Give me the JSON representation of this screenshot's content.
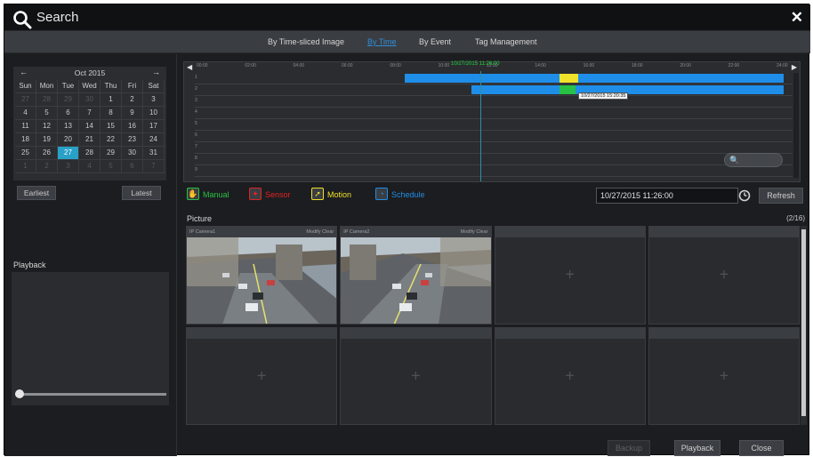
{
  "window": {
    "title": "Search",
    "close_symbol": "✕"
  },
  "tabs": [
    {
      "label": "By Time-sliced Image",
      "active": false
    },
    {
      "label": "By Time",
      "active": true
    },
    {
      "label": "By Event",
      "active": false
    },
    {
      "label": "Tag Management",
      "active": false
    }
  ],
  "calendar": {
    "month_label": "Oct  2015",
    "prev_symbol": "←",
    "next_symbol": "→",
    "weekdays": [
      "Sun",
      "Mon",
      "Tue",
      "Wed",
      "Thu",
      "Fri",
      "Sat"
    ],
    "days": [
      {
        "d": "27",
        "dim": true
      },
      {
        "d": "28",
        "dim": true
      },
      {
        "d": "29",
        "dim": true
      },
      {
        "d": "30",
        "dim": true
      },
      {
        "d": "1",
        "dim": false
      },
      {
        "d": "2",
        "dim": false
      },
      {
        "d": "3",
        "dim": false
      },
      {
        "d": "4",
        "dim": false
      },
      {
        "d": "5",
        "dim": false
      },
      {
        "d": "6",
        "dim": false
      },
      {
        "d": "7",
        "dim": false
      },
      {
        "d": "8",
        "dim": false
      },
      {
        "d": "9",
        "dim": false
      },
      {
        "d": "10",
        "dim": false
      },
      {
        "d": "11",
        "dim": false
      },
      {
        "d": "12",
        "dim": false
      },
      {
        "d": "13",
        "dim": false
      },
      {
        "d": "14",
        "dim": false
      },
      {
        "d": "15",
        "dim": false
      },
      {
        "d": "16",
        "dim": false
      },
      {
        "d": "17",
        "dim": false
      },
      {
        "d": "18",
        "dim": false
      },
      {
        "d": "19",
        "dim": false
      },
      {
        "d": "20",
        "dim": false
      },
      {
        "d": "21",
        "dim": false
      },
      {
        "d": "22",
        "dim": false
      },
      {
        "d": "23",
        "dim": false
      },
      {
        "d": "24",
        "dim": false
      },
      {
        "d": "25",
        "dim": false
      },
      {
        "d": "26",
        "dim": false
      },
      {
        "d": "27",
        "dim": false,
        "selected": true
      },
      {
        "d": "28",
        "dim": false
      },
      {
        "d": "29",
        "dim": false
      },
      {
        "d": "30",
        "dim": false
      },
      {
        "d": "31",
        "dim": false
      },
      {
        "d": "1",
        "dim": true
      },
      {
        "d": "2",
        "dim": true
      },
      {
        "d": "3",
        "dim": true
      },
      {
        "d": "4",
        "dim": true
      },
      {
        "d": "5",
        "dim": true
      },
      {
        "d": "6",
        "dim": true
      },
      {
        "d": "7",
        "dim": true
      }
    ],
    "earliest_label": "Earliest",
    "latest_label": "Latest"
  },
  "playback": {
    "label": "Playback",
    "slider_value": 0
  },
  "timeline": {
    "left_arrow": "◀",
    "right_arrow": "▶",
    "current_time_label": "10/27/2015 11:26:00",
    "tick_labels": [
      "00:00",
      "02:00",
      "04:00",
      "06:00",
      "08:00",
      "10:00",
      "12:00",
      "14:00",
      "16:00",
      "18:00",
      "20:00",
      "22:00",
      "24:00"
    ],
    "row_numbers": [
      "1",
      "2",
      "3",
      "4",
      "5",
      "6",
      "7",
      "8",
      "9"
    ],
    "tooltip": "10/27/2015 15:20:35",
    "zoom_icon": "🔍",
    "colors": {
      "schedule": "#1f8ee8",
      "motion": "#f0e22a",
      "manual": "#27c243"
    }
  },
  "legend": [
    {
      "label": "Manual",
      "color": "#27c243",
      "icon": "hand-icon",
      "glyph": "✋"
    },
    {
      "label": "Sensor",
      "color": "#e02424",
      "icon": "sensor-icon",
      "glyph": "✦"
    },
    {
      "label": "Motion",
      "color": "#f0e22a",
      "icon": "motion-icon",
      "glyph": "➚"
    },
    {
      "label": "Schedule",
      "color": "#1f8ee8",
      "icon": "schedule-icon",
      "glyph": "◔"
    }
  ],
  "datetime": {
    "value": "10/27/2015 11:26:00"
  },
  "refresh_label": "Refresh",
  "picture": {
    "label": "Picture",
    "count": "(2/16)",
    "cells": [
      {
        "camera": "IP Camera1",
        "modify": "Modify",
        "clear": "Clear",
        "has_image": true
      },
      {
        "camera": "IP Camera2",
        "modify": "Modify",
        "clear": "Clear",
        "has_image": true
      },
      {
        "camera": "",
        "has_image": false
      },
      {
        "camera": "",
        "has_image": false
      },
      {
        "camera": "",
        "has_image": false
      },
      {
        "camera": "",
        "has_image": false
      },
      {
        "camera": "",
        "has_image": false
      },
      {
        "camera": "",
        "has_image": false
      }
    ],
    "plus_symbol": "+"
  },
  "footer": {
    "backup_label": "Backup",
    "playback_label": "Playback",
    "close_label": "Close"
  }
}
